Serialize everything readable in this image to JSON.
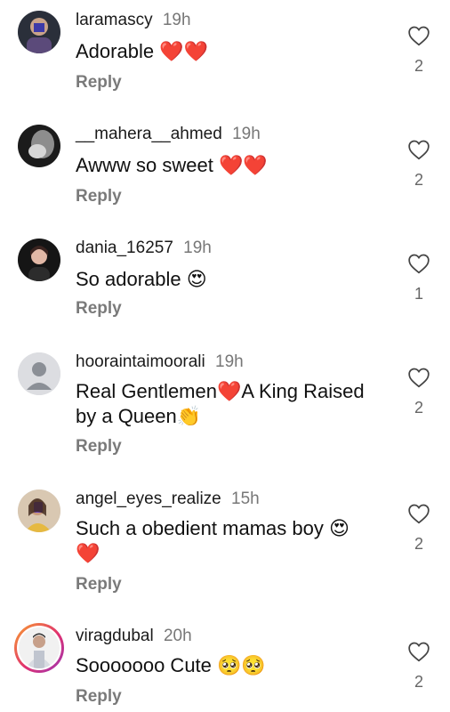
{
  "comments": [
    {
      "username": "laramascy",
      "time": "19h",
      "text": "Adorable ❤️❤️",
      "reply": "Reply",
      "likes": "2",
      "icon": "heart-outline-icon"
    },
    {
      "username": "__mahera__ahmed",
      "time": "19h",
      "text": "Awww so sweet ❤️❤️",
      "reply": "Reply",
      "likes": "2",
      "icon": "heart-outline-icon"
    },
    {
      "username": "dania_16257",
      "time": "19h",
      "text": "So adorable 😍",
      "reply": "Reply",
      "likes": "1",
      "icon": "heart-outline-icon"
    },
    {
      "username": "hooraintaimoorali",
      "time": "19h",
      "text": "Real Gentlemen❤️A King Raised by a Queen👏",
      "reply": "Reply",
      "likes": "2",
      "icon": "heart-outline-icon"
    },
    {
      "username": "angel_eyes_realize",
      "time": "15h",
      "text": "Such a obedient mamas boy 😍 ❤️",
      "reply": "Reply",
      "likes": "2",
      "icon": "heart-outline-icon"
    },
    {
      "username": "viragdubal",
      "time": "20h",
      "text": "Sooooooo Cute 🥺🥺",
      "reply": "Reply",
      "likes": "2",
      "icon": "heart-outline-icon"
    }
  ],
  "colors": {
    "username": "#1a1a1a",
    "meta": "#777777",
    "reply": "#7a7a7a",
    "story_ring_start": "#f9a12e",
    "story_ring_end": "#9b36b7"
  }
}
